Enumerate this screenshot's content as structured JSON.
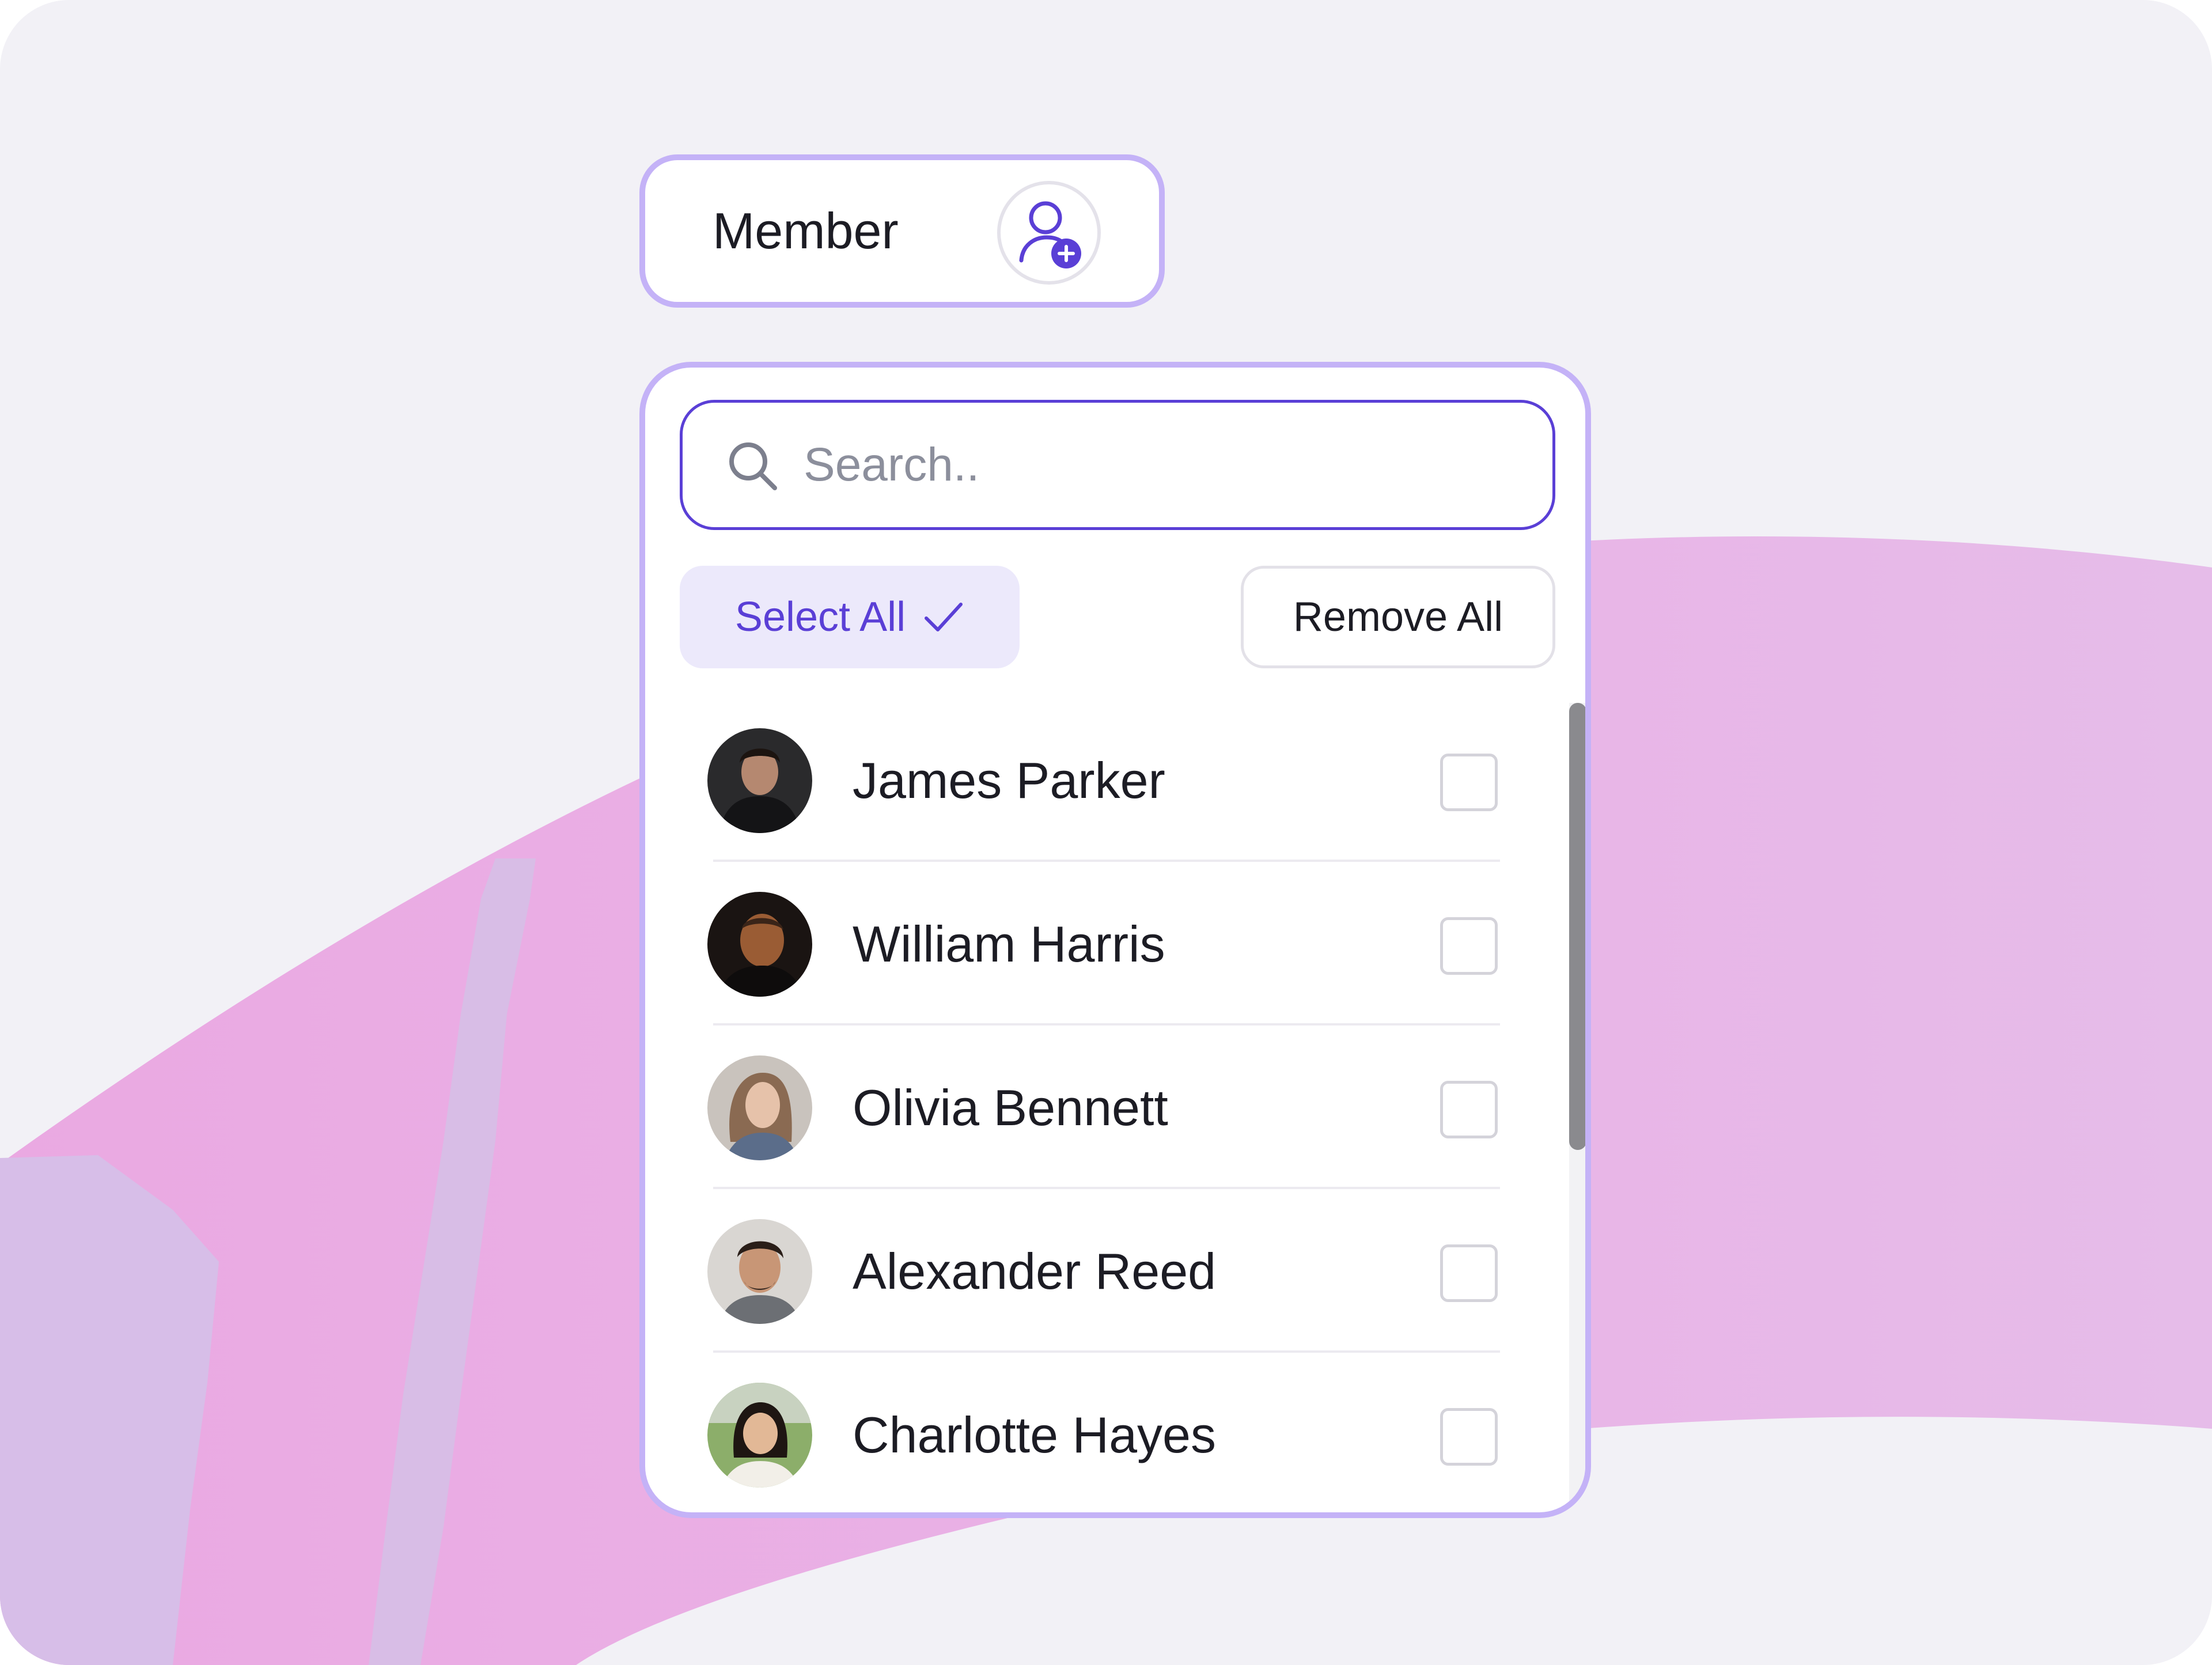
{
  "member_field": {
    "label": "Member",
    "add_icon": "user-plus-icon"
  },
  "dropdown": {
    "search": {
      "placeholder": "Search..",
      "value": "",
      "icon": "search-icon"
    },
    "select_all_label": "Select All",
    "select_all_icon": "check-icon",
    "remove_all_label": "Remove All",
    "members": [
      {
        "name": "James Parker",
        "checked": false
      },
      {
        "name": "William Harris",
        "checked": false
      },
      {
        "name": "Olivia Bennett",
        "checked": false
      },
      {
        "name": "Alexander Reed",
        "checked": false
      },
      {
        "name": "Charlotte Hayes",
        "checked": false
      }
    ]
  },
  "colors": {
    "accent": "#5a3fd6",
    "border": "#c4b2f7",
    "select_all_bg": "#ece9fb",
    "background": "#f2f1f6",
    "wave_pink": "#e8b2e6"
  }
}
